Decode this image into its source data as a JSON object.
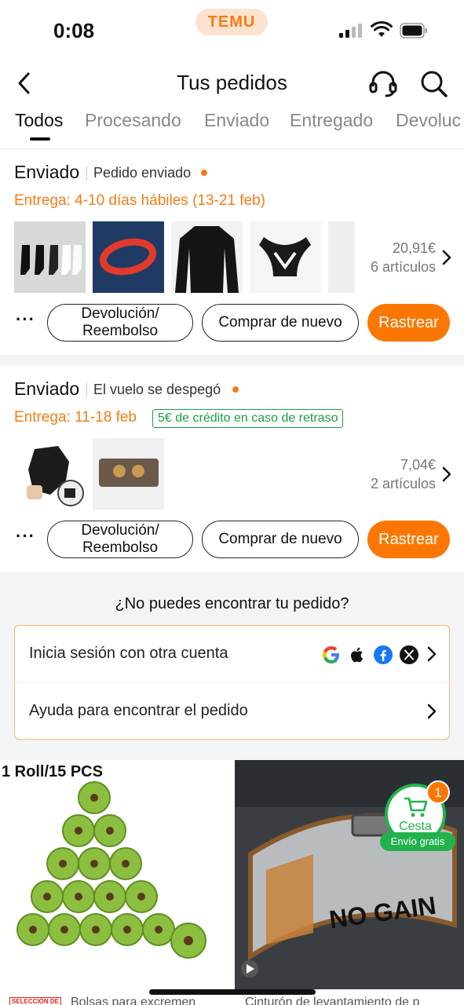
{
  "status_bar": {
    "time": "0:08",
    "app_badge": "TEMU"
  },
  "header": {
    "title": "Tus pedidos"
  },
  "tabs": [
    {
      "label": "Todos"
    },
    {
      "label": "Procesando"
    },
    {
      "label": "Enviado"
    },
    {
      "label": "Entregado"
    },
    {
      "label": "Devoluc"
    }
  ],
  "orders": [
    {
      "status": "Enviado",
      "substatus": "Pedido enviado",
      "delivery": "Entrega: 4-10 días hábiles (13-21 feb)",
      "price": "20,91€",
      "items": "6 artículos",
      "return_label_1": "Devolución/",
      "return_label_2": "Reembolso",
      "buy_again": "Comprar de nuevo",
      "track": "Rastrear"
    },
    {
      "status": "Enviado",
      "substatus": "El vuelo se despegó",
      "delivery": "Entrega: 11-18 feb",
      "credit_badge": "5€ de crédito en caso de retraso",
      "price": "7,04€",
      "items": "2 artículos",
      "return_label_1": "Devolución/",
      "return_label_2": "Reembolso",
      "buy_again": "Comprar de nuevo",
      "track": "Rastrear"
    }
  ],
  "help": {
    "title": "¿No puedes encontrar tu pedido?",
    "row1": "Inicia sesión con otra cuenta",
    "row2": "Ayuda para encontrar el pedido"
  },
  "products": [
    {
      "overlay": "1 Roll/15 PCS",
      "badge": "SELECCIÓN DE",
      "caption": "Bolsas para excremen"
    },
    {
      "overlay": "NO GAIN",
      "caption": "Cinturón de levantamiento de p"
    }
  ],
  "cart": {
    "label": "Cesta",
    "count": "1",
    "free_shipping": "Envío gratis"
  },
  "colors": {
    "accent": "#fb7701",
    "green": "#21b24b"
  }
}
